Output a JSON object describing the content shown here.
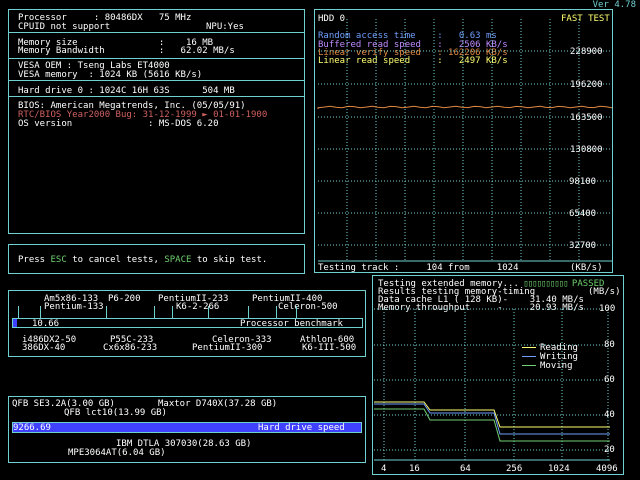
{
  "version": "Ver 4.78",
  "sysinfo": {
    "processor_label": "Processor     : 80486DX   75 MHz",
    "cpuid_label": "CPUID not support",
    "npu_label": "NPU:Yes",
    "mem_size": "Memory size               :    16 MB",
    "mem_bw": "Memory Bandwidth          :   62.02 MB/s",
    "vesa_oem": "VESA OEM : Tseng Labs ET4000",
    "vesa_mem": "VESA memory  : 1024 KB (5616 KB/s)",
    "hdd": "Hard drive 0 : 1024C 16H 63S      504 MB",
    "bios": "BIOS: American Megatrends, Inc. (05/05/91)",
    "y2k": "RTC/BIOS Year2000 Bug: 31-12-1999 ► 01-01-1900",
    "os": "OS version              : MS-DOS 6.20"
  },
  "hint": {
    "p1": "Press ",
    "esc": "ESC",
    "p2": " to cancel tests, ",
    "space": "SPACE",
    "p3": " to skip test."
  },
  "hdd_panel": {
    "title": "HDD 0",
    "mode": "FAST TEST",
    "random_access": "Random access time    :   0.63 ms",
    "buffered_read": "Buffered read speed   :   2506 KB/s",
    "linear_verify": "Linear verify speed   : 162206 KB/s",
    "linear_read": "Linear read speed     :   2497 KB/s",
    "yticks": [
      "228900",
      "196200",
      "163500",
      "130800",
      "98100",
      "65400",
      "32700"
    ],
    "status": "Testing track :     104 from     1024",
    "unit": "(KB/s)"
  },
  "mem_panel": {
    "line1": "Testing extended memory...",
    "passed": "PASSED",
    "line2": "Results testing memory-timing",
    "unit": "(MB/s)",
    "line3": "Data cache L1 ( 128 KB)-    31.40 MB/s",
    "line4": "Memory throughput     -     20.93 MB/s",
    "yticks": [
      "100",
      "80",
      "60",
      "40",
      "20"
    ],
    "xticks": [
      "4",
      "16",
      "64",
      "256",
      "1024",
      "4096"
    ],
    "legend": [
      "Reading",
      "Writing",
      "Moving"
    ],
    "legend_colors": [
      "#ffff6f",
      "#6f9fff",
      "#6fd06f"
    ]
  },
  "cpu_bench": {
    "top_labels": [
      "Am5x86-133",
      "P6-200",
      "PentiumII-233",
      "PentiumII-400",
      "Pentium-133",
      "K6-2-266",
      "Celeron-500"
    ],
    "bottom_labels": [
      "i486DX2-50",
      "P55C-233",
      "Celeron-333",
      "Athlon-600",
      "386DX-40",
      "Cx6x86-233",
      "PentiumII-300",
      "K6-III-500"
    ],
    "value": "10.66",
    "label": "Processor benchmark",
    "fill": 0.012
  },
  "hd_bench": {
    "top_labels": [
      "QFB SE3.2A(3.00 GB)",
      "Maxtor D740X(37.28 GB)",
      "QFB lct10(13.99 GB)"
    ],
    "bottom_labels": [
      "IBM DTLA 307030(28.63 GB)",
      "MPE3064AT(6.04 GB)"
    ],
    "value": "9266.69",
    "label": "Hard drive speed"
  }
}
